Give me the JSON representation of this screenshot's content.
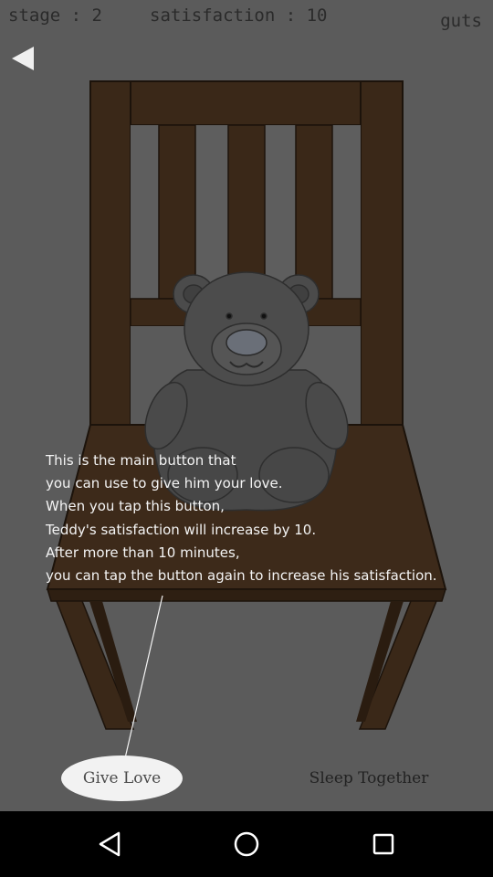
{
  "hud": {
    "stage": "stage : 2",
    "satisfaction": "satisfaction : 10",
    "guts": "guts"
  },
  "tutorial": {
    "lines": [
      "This is the main button that",
      "you can use to give him your love.",
      "When you tap this button,",
      "Teddy's satisfaction will increase by 10.",
      "After more than 10 minutes,",
      "you can tap the button again to increase his satisfaction."
    ]
  },
  "buttons": {
    "give_love": "Give Love",
    "sleep_together": "Sleep Together"
  },
  "icons": {
    "back": "back-arrow-icon",
    "nav_back": "triangle-back-icon",
    "nav_home": "circle-home-icon",
    "nav_recents": "square-recents-icon"
  },
  "colors": {
    "background": "#5b5b5b",
    "chair_wood": "#3d2a1a",
    "teddy": "#4a4a4a",
    "tutorial_text": "#f4f4f4",
    "button_bg": "#f2f2f2"
  }
}
